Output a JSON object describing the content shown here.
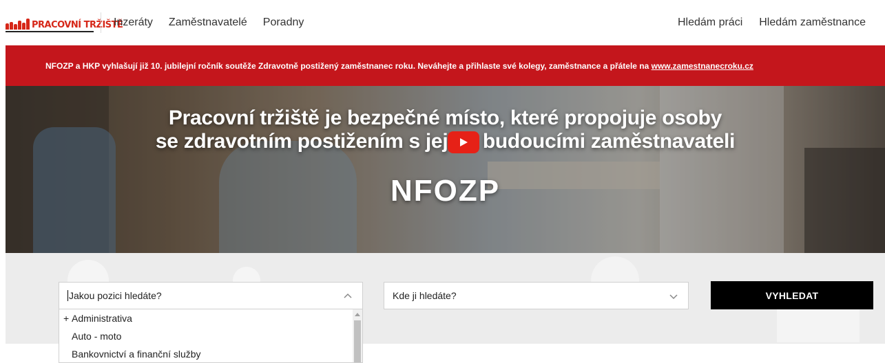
{
  "header": {
    "logo": "PRACOVNÍ TRŽIŠTĚ",
    "nav_left": [
      "Inzeráty",
      "Zaměstnavatelé",
      "Poradny"
    ],
    "nav_right": [
      "Hledám práci",
      "Hledám zaměstnance"
    ]
  },
  "banner": {
    "text": "NFOZP a HKP vyhlašují již 10. jubilejní ročník soutěže Zdravotně postižený zaměstnanec roku. Neváhejte a přihlaste své kolegy, zaměstnance a přátele na ",
    "link": "www.zamestnanecroku.cz",
    "background": "#c4161c"
  },
  "hero": {
    "title_line1": "Pracovní tržiště je bezpečné místo, které propojuje osoby",
    "title_line2": "se zdravotním postižením s jejich budoucími zaměstnavateli",
    "brand": "NFOZP",
    "play_icon": "youtube-play-icon"
  },
  "search": {
    "position_placeholder": "Jakou pozici hledáte?",
    "location_placeholder": "Kde ji hledáte?",
    "button_label": "VYHLEDAT",
    "options": [
      "Administrativa",
      "Auto - moto",
      "Bankovnictví a finanční služby"
    ]
  },
  "colors": {
    "brand_red": "#d62718",
    "button": "#000000"
  }
}
